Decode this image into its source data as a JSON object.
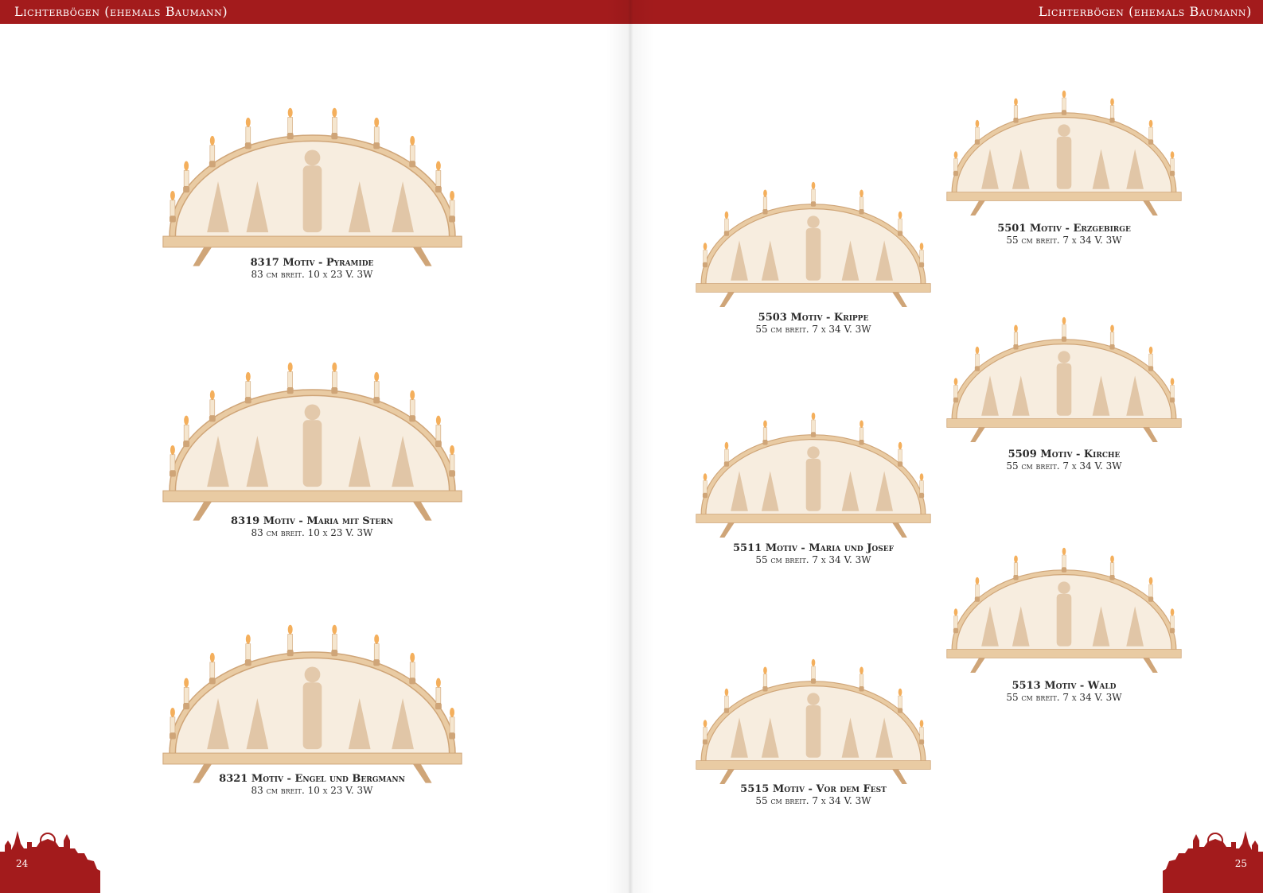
{
  "header": {
    "title_left": "Lichterbögen (ehemals Baumann)",
    "title_right": "Lichterbögen (ehemals Baumann)"
  },
  "pages": {
    "left_number": "24",
    "right_number": "25"
  },
  "colors": {
    "brand_red": "#a31b1c",
    "wood": "#e9cba3",
    "wood_dark": "#cfa578"
  },
  "products": [
    {
      "title": "8317 Motiv - Pyramide",
      "spec": "83 cm breit. 10 x 23 V. 3W",
      "candles": 10
    },
    {
      "title": "8319 Motiv - Maria mit Stern",
      "spec": "83 cm breit. 10 x 23 V. 3W",
      "candles": 10
    },
    {
      "title": "8321 Motiv - Engel und Bergmann",
      "spec": "83 cm breit. 10 x 23 V. 3W",
      "candles": 10
    },
    {
      "title": "5503 Motiv - Krippe",
      "spec": "55 cm breit. 7 x 34 V. 3W",
      "candles": 7
    },
    {
      "title": "5511 Motiv - Maria und Josef",
      "spec": "55 cm breit. 7 x 34 V. 3W",
      "candles": 7
    },
    {
      "title": "5515 Motiv - Vor dem Fest",
      "spec": "55 cm breit. 7 x 34 V. 3W",
      "candles": 7
    },
    {
      "title": "5501 Motiv - Erzgebirge",
      "spec": "55 cm breit. 7 x 34 V. 3W",
      "candles": 7
    },
    {
      "title": "5509 Motiv - Kirche",
      "spec": "55 cm breit. 7 x 34 V. 3W",
      "candles": 7
    },
    {
      "title": "5513 Motiv - Wald",
      "spec": "55 cm breit. 7 x 34 V. 3W",
      "candles": 7
    }
  ]
}
